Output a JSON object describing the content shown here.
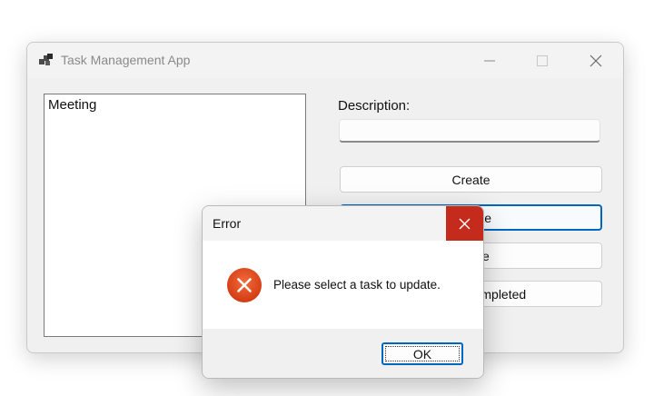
{
  "window": {
    "title": "Task Management App",
    "icon": "app-window-icon"
  },
  "task_list": {
    "items": [
      "Meeting"
    ]
  },
  "form": {
    "description_label": "Description:",
    "description_value": ""
  },
  "buttons": {
    "create": "Create",
    "update": "Update",
    "delete": "Delete",
    "mark_completed": "Mark as Completed"
  },
  "dialog": {
    "title": "Error",
    "message": "Please select a task to update.",
    "ok_label": "OK",
    "icon": "error-icon"
  },
  "colors": {
    "close_red": "#c42b1c",
    "error_orange": "#e0481e",
    "focus_blue": "#0067c0"
  }
}
